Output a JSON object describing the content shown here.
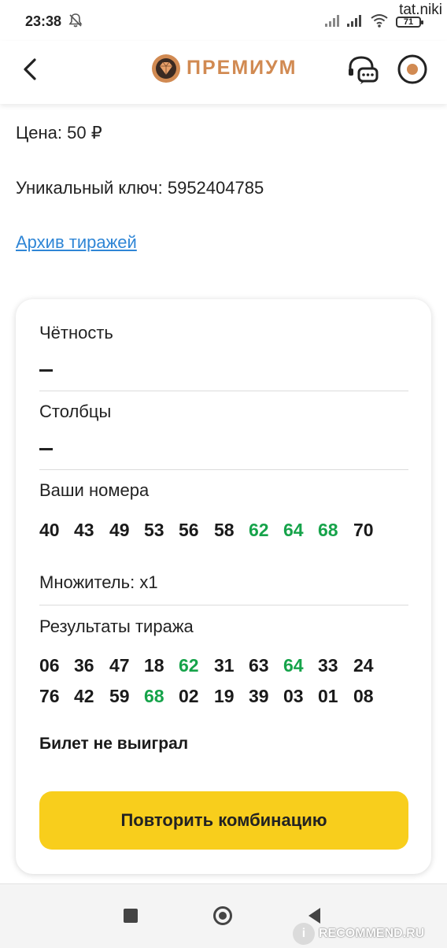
{
  "status_bar": {
    "time": "23:38",
    "battery": "71",
    "watermark_user": "tat.niki"
  },
  "header": {
    "logo_text": "ПРЕМИУМ",
    "brand_color": "#d18a52",
    "icons": {
      "back": "chevron-left-icon",
      "logo": "gem-icon",
      "support": "chat-headset-icon",
      "profile": "profile-ring-icon"
    }
  },
  "ticket": {
    "price": "Цена: 50 ₽",
    "unique_key": "Уникальный ключ: 5952404785",
    "archive_link": "Архив тиражей"
  },
  "card": {
    "parity_label": "Чётность",
    "columns_label": "Столбцы",
    "your_numbers_label": "Ваши номера",
    "your_numbers": [
      {
        "n": "40",
        "hit": false
      },
      {
        "n": "43",
        "hit": false
      },
      {
        "n": "49",
        "hit": false
      },
      {
        "n": "53",
        "hit": false
      },
      {
        "n": "56",
        "hit": false
      },
      {
        "n": "58",
        "hit": false
      },
      {
        "n": "62",
        "hit": true
      },
      {
        "n": "64",
        "hit": true
      },
      {
        "n": "68",
        "hit": true
      },
      {
        "n": "70",
        "hit": false
      }
    ],
    "multiplier": "Множитель: x1",
    "results_label": "Результаты тиража",
    "results_row1": [
      {
        "n": "06",
        "hit": false
      },
      {
        "n": "36",
        "hit": false
      },
      {
        "n": "47",
        "hit": false
      },
      {
        "n": "18",
        "hit": false
      },
      {
        "n": "62",
        "hit": true
      },
      {
        "n": "31",
        "hit": false
      },
      {
        "n": "63",
        "hit": false
      },
      {
        "n": "64",
        "hit": true
      },
      {
        "n": "33",
        "hit": false
      },
      {
        "n": "24",
        "hit": false
      }
    ],
    "results_row2": [
      {
        "n": "76",
        "hit": false
      },
      {
        "n": "42",
        "hit": false
      },
      {
        "n": "59",
        "hit": false
      },
      {
        "n": "68",
        "hit": true
      },
      {
        "n": "02",
        "hit": false
      },
      {
        "n": "19",
        "hit": false
      },
      {
        "n": "39",
        "hit": false
      },
      {
        "n": "03",
        "hit": false
      },
      {
        "n": "01",
        "hit": false
      },
      {
        "n": "08",
        "hit": false
      }
    ],
    "result_text": "Билет не выиграл",
    "repeat_button": "Повторить комбинацию",
    "hit_color": "#16a34a",
    "button_color": "#f8ce1c"
  },
  "watermark": {
    "badge": "i",
    "text": "RECOMMEND.RU"
  }
}
